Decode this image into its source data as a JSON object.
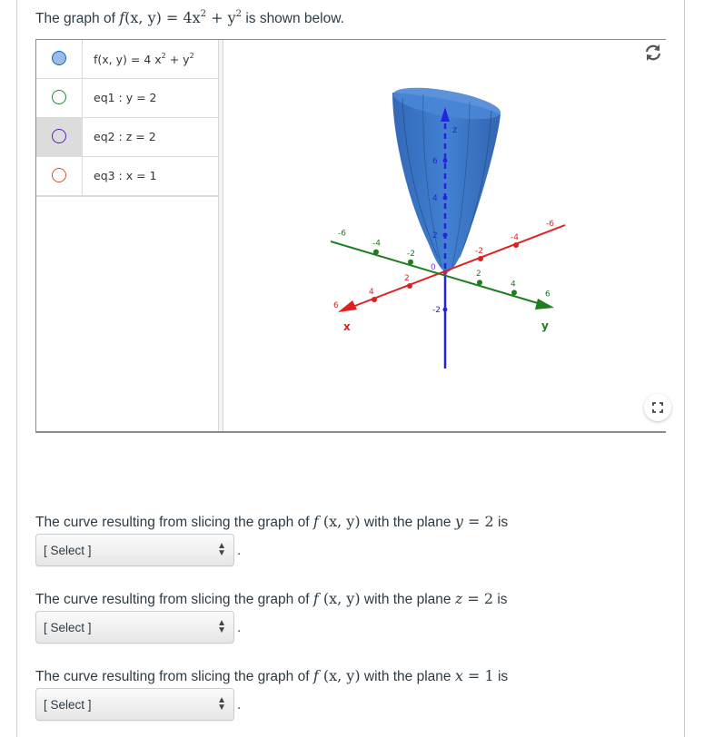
{
  "intro": {
    "prefix": "The graph of ",
    "suffix": " is shown below.",
    "function_label": "f",
    "function_args": "(x, y)",
    "equals": " = 4x",
    "exp1": "2",
    "plus": " + y",
    "exp2": "2"
  },
  "applet": {
    "algebra_items": [
      {
        "text_main": "f(x, y)  =  4 x",
        "sup1": "2",
        "mid": " + y",
        "sup2": "2",
        "marble_color": "#1565c0",
        "marble_fill": "#99bbe8",
        "selected": false
      },
      {
        "text": "eq1 :  y = 2",
        "marble_color": "#1b8a3c",
        "marble_fill": "none",
        "selected": false
      },
      {
        "text": "eq2 :  z = 2",
        "marble_color": "#5b21b6",
        "marble_fill": "none",
        "selected": true
      },
      {
        "text": "eq3 :  x = 1",
        "marble_color": "#d9502a",
        "marble_fill": "none",
        "selected": false
      }
    ],
    "refresh_icon": "refresh-icon",
    "fullscreen_icon": "fullscreen-icon",
    "axes": {
      "x": {
        "label": "x",
        "color": "#e02020",
        "ticks": [
          "-6",
          "-4",
          "-2",
          "2",
          "4",
          "6"
        ]
      },
      "y": {
        "label": "y",
        "color": "#1e7d1e",
        "ticks": [
          "-6",
          "-4",
          "-2",
          "2",
          "4",
          "6"
        ]
      },
      "z": {
        "label": "z",
        "color": "#2424e0",
        "ticks": [
          "-2",
          "2",
          "4",
          "6"
        ]
      },
      "origin_labels": [
        "0",
        "0",
        "0"
      ]
    },
    "surface_color": "#2f6fc4"
  },
  "questions": [
    {
      "prefix": "The curve resulting from slicing the graph of ",
      "func": "f",
      "args": "(x, y)",
      "middle": " with the plane ",
      "var": "y",
      "eq": " = 2",
      "suffix": " is",
      "select_label": "[ Select ]",
      "period": "."
    },
    {
      "prefix": "The curve resulting from slicing the graph of ",
      "func": "f",
      "args": "(x, y)",
      "middle": " with the plane ",
      "var": "z",
      "eq": " = 2",
      "suffix": " is",
      "select_label": "[ Select ]",
      "period": "."
    },
    {
      "prefix": "The curve resulting from slicing the graph of ",
      "func": "f",
      "args": "(x, y)",
      "middle": " with the plane ",
      "var": "x",
      "eq": " = 1",
      "suffix": " is",
      "select_label": "[ Select ]",
      "period": "."
    }
  ]
}
